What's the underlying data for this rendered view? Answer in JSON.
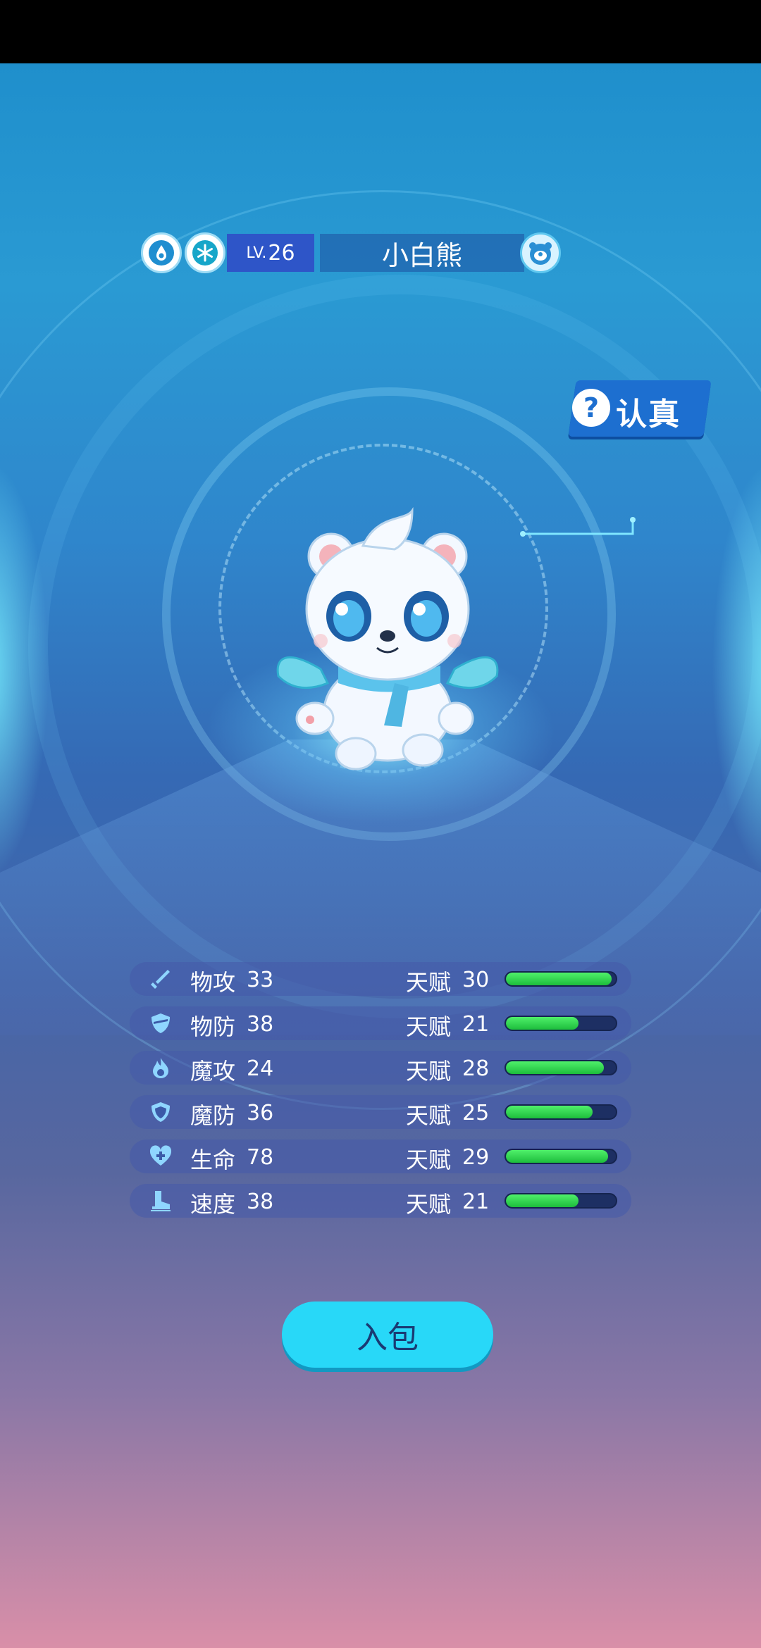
{
  "pet": {
    "level_prefix": "LV.",
    "level": "26",
    "name": "小白熊",
    "element_icons": [
      "water-element-icon",
      "ice-element-icon"
    ],
    "badge_icon": "bear-face-icon"
  },
  "nature": {
    "question": "?",
    "label": "认真"
  },
  "stats": [
    {
      "icon": "sword-icon",
      "name": "物攻",
      "value": "33",
      "talent_label": "天赋",
      "talent": "30",
      "fill": 0.96
    },
    {
      "icon": "shield-icon",
      "name": "物防",
      "value": "38",
      "talent_label": "天赋",
      "talent": "21",
      "fill": 0.66
    },
    {
      "icon": "flame-icon",
      "name": "魔攻",
      "value": "24",
      "talent_label": "天赋",
      "talent": "28",
      "fill": 0.89
    },
    {
      "icon": "magic-shield-icon",
      "name": "魔防",
      "value": "36",
      "talent_label": "天赋",
      "talent": "25",
      "fill": 0.79
    },
    {
      "icon": "heart-plus-icon",
      "name": "生命",
      "value": "78",
      "talent_label": "天赋",
      "talent": "29",
      "fill": 0.93
    },
    {
      "icon": "boot-icon",
      "name": "速度",
      "value": "38",
      "talent_label": "天赋",
      "talent": "21",
      "fill": 0.66
    }
  ],
  "button": {
    "label": "入包"
  },
  "colors": {
    "bar_fill": "#2fd24c",
    "button": "#28d8f8",
    "level_box": "#2e55c8"
  }
}
